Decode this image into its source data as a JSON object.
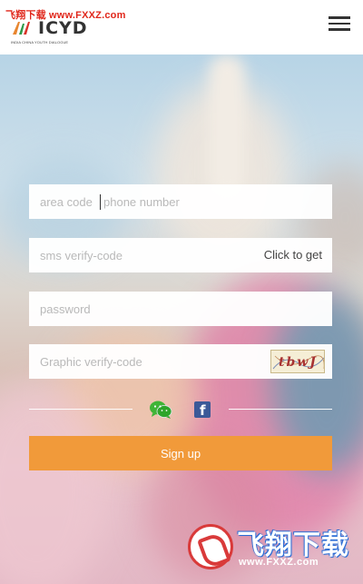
{
  "header": {
    "watermark_text": "飞翔下载 www.FXXZ.com",
    "logo_brand": "ICYD",
    "logo_tagline": "INDIA CHINA YOUTH DIALOGUE",
    "menu_icon": "hamburger-menu-icon"
  },
  "form": {
    "area_code_placeholder": "area code",
    "phone_placeholder": "phone number",
    "sms_placeholder": "sms verify-code",
    "get_code_label": "Click to get",
    "password_placeholder": "password",
    "graphic_placeholder": "Graphic verify-code",
    "captcha_text": "tbwJ"
  },
  "social": {
    "wechat_icon": "wechat-icon",
    "facebook_icon": "facebook-icon",
    "facebook_glyph": "f"
  },
  "actions": {
    "signup_label": "Sign up",
    "signup_color": "#f19a3a"
  },
  "watermark": {
    "title": "飞翔下载",
    "url": "www.FXXZ.com"
  }
}
